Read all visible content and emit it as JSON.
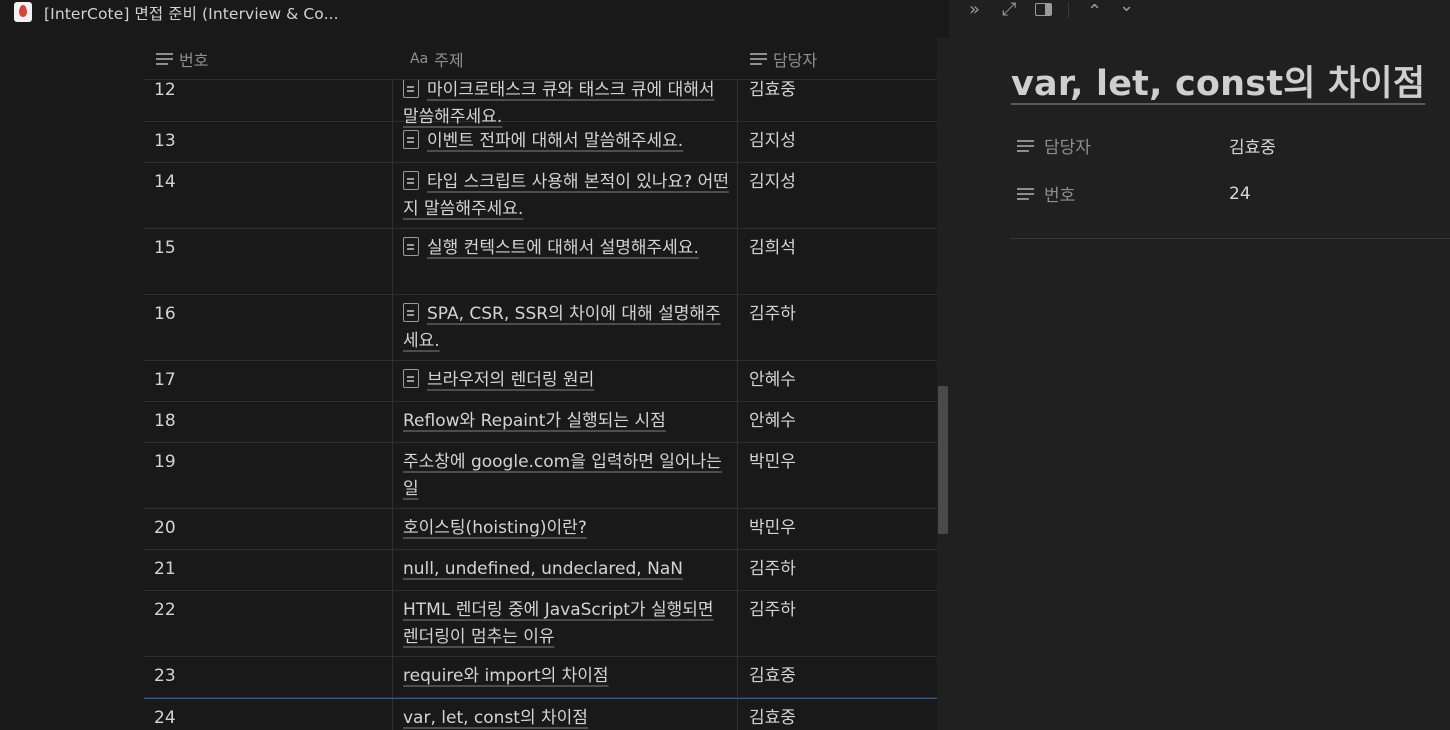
{
  "window": {
    "title": "[InterCote] 면접 준비 (Interview & Co..."
  },
  "table": {
    "columns": [
      {
        "label": "번호",
        "icon": "lines-icon"
      },
      {
        "label": "주제",
        "icon": "aa-icon",
        "icon_text": "Aa"
      },
      {
        "label": "담당자",
        "icon": "lines-icon"
      }
    ],
    "rows": [
      {
        "num": "12",
        "topic": "마이크로태스크 큐와 태스크 큐에 대해서 말씀해주세요.",
        "owner": "김효중",
        "has_page_icon": true
      },
      {
        "num": "13",
        "topic": "이벤트 전파에 대해서 말씀해주세요.",
        "owner": "김지성",
        "has_page_icon": true
      },
      {
        "num": "14",
        "topic": "타입 스크립트 사용해 본적이 있나요? 어떤지 말씀해주세요.",
        "owner": "김지성",
        "has_page_icon": true
      },
      {
        "num": "15",
        "topic": "실행 컨텍스트에 대해서 설명해주세요.",
        "owner": "김희석",
        "has_page_icon": true
      },
      {
        "num": "16",
        "topic": "SPA, CSR, SSR의 차이에 대해 설명해주세요.",
        "owner": "김주하",
        "has_page_icon": true
      },
      {
        "num": "17",
        "topic": "브라우저의 렌더링 원리",
        "owner": "안혜수",
        "has_page_icon": true
      },
      {
        "num": "18",
        "topic": "Reflow와 Repaint가 실행되는 시점",
        "owner": "안혜수",
        "has_page_icon": false
      },
      {
        "num": "19",
        "topic": "주소창에 google.com을 입력하면 일어나는 일",
        "owner": "박민우",
        "has_page_icon": false
      },
      {
        "num": "20",
        "topic": "호이스팅(hoisting)이란?",
        "owner": "박민우",
        "has_page_icon": false
      },
      {
        "num": "21",
        "topic": "null, undefined, undeclared, NaN",
        "owner": "김주하",
        "has_page_icon": false
      },
      {
        "num": "22",
        "topic": "HTML 렌더링 중에 JavaScript가 실행되면 렌더링이 멈추는 이유",
        "owner": "김주하",
        "has_page_icon": false
      },
      {
        "num": "23",
        "topic": "require와 import의 차이점",
        "owner": "김효중",
        "has_page_icon": false
      },
      {
        "num": "24",
        "topic": "var, let, const의 차이점",
        "owner": "김효중",
        "has_page_icon": false
      }
    ]
  },
  "peek": {
    "toolbar": {
      "expand_all": "»",
      "fullscreen": "⤢",
      "up": "⌃",
      "down": "⌄"
    },
    "title": "var, let, const의 차이점",
    "properties": [
      {
        "name": "담당자",
        "value": "김효중"
      },
      {
        "name": "번호",
        "value": "24"
      }
    ]
  },
  "colors": {
    "background": "#191919",
    "peek_background": "#202020",
    "text": "#d4d4d4",
    "muted": "#8f8f8f",
    "selection_border": "#3d5a80"
  }
}
